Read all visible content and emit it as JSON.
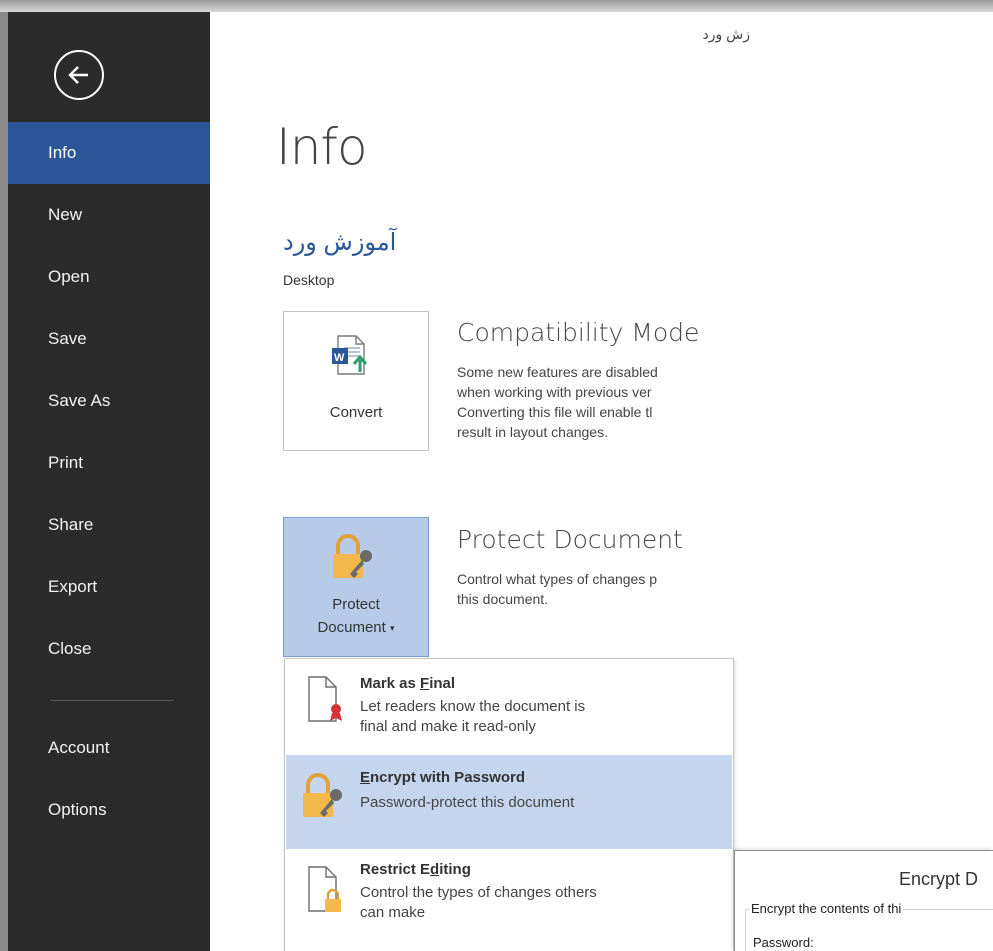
{
  "window": {
    "doc_title": "زش ورد"
  },
  "sidebar": {
    "items": [
      {
        "label": "Info",
        "active": true
      },
      {
        "label": "New"
      },
      {
        "label": "Open"
      },
      {
        "label": "Save"
      },
      {
        "label": "Save As"
      },
      {
        "label": "Print"
      },
      {
        "label": "Share"
      },
      {
        "label": "Export"
      },
      {
        "label": "Close"
      },
      {
        "label": "Account"
      },
      {
        "label": "Options"
      }
    ]
  },
  "main": {
    "page_title": "Info",
    "file_name": "آموزش ورد",
    "file_location": "Desktop",
    "convert": {
      "button_label": "Convert",
      "heading": "Compatibility Mode",
      "description": "Some new features are disabled\nwhen working with previous ver\nConverting this file will enable tl\nresult in layout changes."
    },
    "protect": {
      "button_label_line1": "Protect",
      "button_label_line2": "Document",
      "heading": "Protect Document",
      "description": "Control what types of changes p\nthis document."
    }
  },
  "dropdown": {
    "items": [
      {
        "title_pre": "Mark as ",
        "title_key": "F",
        "title_post": "inal",
        "description": "Let readers know the document is\nfinal and make it read-only"
      },
      {
        "title_pre": "",
        "title_key": "E",
        "title_post": "ncrypt with Password",
        "description": "Password-protect this document",
        "highlighted": true
      },
      {
        "title_pre": "Restrict E",
        "title_key": "d",
        "title_post": "iting",
        "description": "Control the types of changes others\ncan make"
      }
    ]
  },
  "dialog": {
    "title": "Encrypt D",
    "group_label": "Encrypt the contents of thi",
    "field_label": "Password:"
  },
  "colors": {
    "sidebar_bg": "#2b2b2b",
    "accent": "#2b579a",
    "highlight": "#c5d5ed"
  }
}
